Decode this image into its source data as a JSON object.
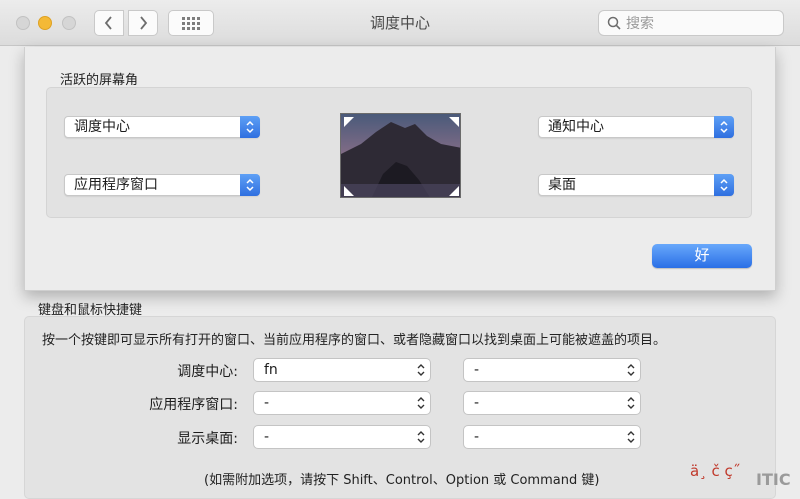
{
  "window": {
    "title": "调度中心",
    "search_placeholder": "搜索"
  },
  "sheet": {
    "section_title": "活跃的屏幕角",
    "top_left": "调度中心",
    "bottom_left": "应用程序窗口",
    "top_right": "通知中心",
    "bottom_right": "桌面",
    "ok_label": "好"
  },
  "shortcuts": {
    "section_title": "键盘和鼠标快捷键",
    "description": "按一个按键即可显示所有打开的窗口、当前应用程序的窗口、或者隐藏窗口以找到桌面上可能被遮盖的项目。",
    "rows": [
      {
        "label": "调度中心:",
        "keyboard": "fn",
        "mouse": "-"
      },
      {
        "label": "应用程序窗口:",
        "keyboard": "-",
        "mouse": "-"
      },
      {
        "label": "显示桌面:",
        "keyboard": "-",
        "mouse": "-"
      }
    ],
    "note": "(如需附加选项，请按下 Shift、Control、Option 或 Command 键)"
  },
  "watermark": {
    "garbled": "ä¸ č ç˝",
    "logo": "ITIC"
  },
  "colors": {
    "accent": "#2f6fe0",
    "minimize": "#f4b936"
  },
  "icons": [
    "chevron-left-icon",
    "chevron-right-icon",
    "grid-icon",
    "search-icon",
    "updown-chevron-icon",
    "hot-corner-icon"
  ]
}
